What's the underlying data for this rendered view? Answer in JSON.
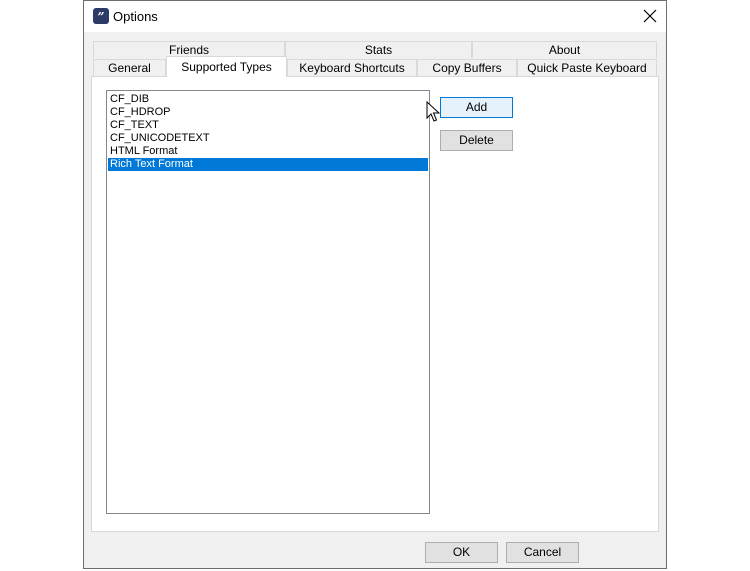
{
  "window": {
    "title": "Options",
    "app_icon_glyph": "”"
  },
  "tabs_row_top": [
    "Friends",
    "Stats",
    "About"
  ],
  "tabs_row_bottom": [
    "General",
    "Supported Types",
    "Keyboard Shortcuts",
    "Copy Buffers",
    "Quick Paste Keyboard"
  ],
  "active_tab": "Supported Types",
  "list": {
    "items": [
      "CF_DIB",
      "CF_HDROP",
      "CF_TEXT",
      "CF_UNICODETEXT",
      "HTML Format",
      "Rich Text Format"
    ],
    "selected_index": 5
  },
  "buttons": {
    "add": "Add",
    "delete": "Delete",
    "ok": "OK",
    "cancel": "Cancel"
  },
  "colors": {
    "selection": "#0078d7",
    "focus_border": "#0078d7",
    "app_icon": "#2b3a67"
  },
  "icons": {
    "close": "close-icon",
    "app": "app-icon",
    "cursor": "mouse-pointer-icon"
  }
}
